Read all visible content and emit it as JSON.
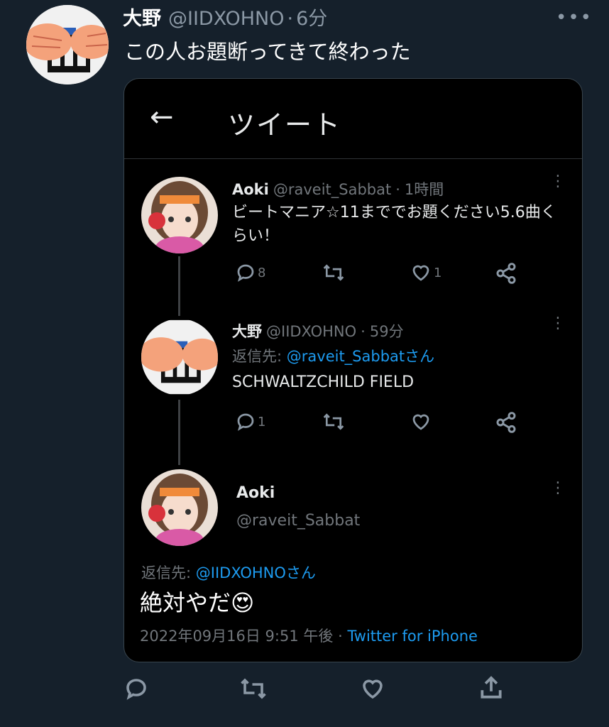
{
  "outer_tweet": {
    "name": "大野",
    "handle": "@IIDXOHNO",
    "time": "6分",
    "more": "•••",
    "text": "この人お題断ってきて終わった"
  },
  "embed": {
    "back_icon": "←",
    "title": "ツイート",
    "tweets": [
      {
        "name": "Aoki",
        "handle": "@raveit_Sabbat",
        "time": "1時間",
        "text": "ビートマニア☆11まででお題ください5.6曲くらい！",
        "reply_count": "8",
        "retweet_count": "",
        "like_count": "1"
      },
      {
        "name": "大野",
        "handle": "@IIDXOHNO",
        "time": "59分",
        "reply_prefix": "返信先: ",
        "reply_to": "@raveit_Sabbatさん",
        "text": "SCHWALTZCHILD FIELD",
        "reply_count": "1",
        "retweet_count": "",
        "like_count": ""
      }
    ],
    "main_tweet": {
      "name": "Aoki",
      "handle": "@raveit_Sabbat",
      "reply_prefix": "返信先: ",
      "reply_to": "@IIDXOHNOさん",
      "text": "絶対やだ",
      "emoji": "😍",
      "date": "2022年09月16日 9:51 午後",
      "client": "Twitter for iPhone"
    }
  },
  "colors": {
    "background": "#15202b",
    "embed_background": "#000000",
    "link": "#1d9bf0",
    "muted": "#71767b"
  }
}
